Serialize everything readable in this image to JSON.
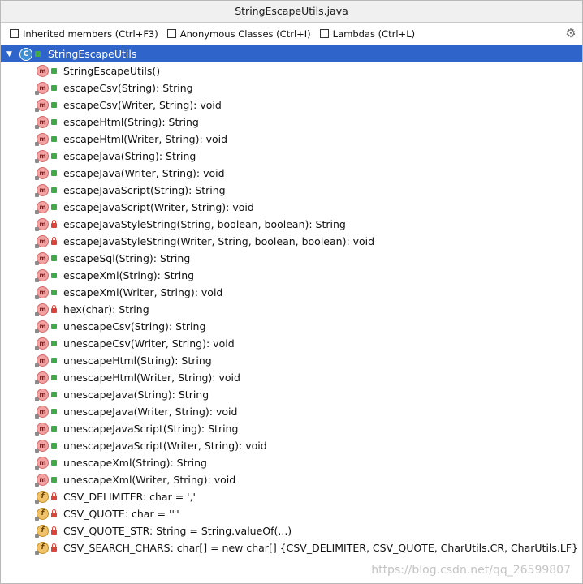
{
  "window": {
    "title": "StringEscapeUtils.java"
  },
  "toolbar": {
    "options": [
      {
        "label": "Inherited members (Ctrl+F3)",
        "checked": false
      },
      {
        "label": "Anonymous Classes (Ctrl+I)",
        "checked": false
      },
      {
        "label": "Lambdas (Ctrl+L)",
        "checked": false
      }
    ],
    "settings_icon": "gear-icon"
  },
  "tree": {
    "root": {
      "label": "StringEscapeUtils",
      "icon": "class-icon",
      "visibility": "public"
    },
    "members": [
      {
        "label": "StringEscapeUtils()",
        "kind": "method",
        "visibility": "public"
      },
      {
        "label": "escapeCsv(String): String",
        "kind": "method",
        "visibility": "public"
      },
      {
        "label": "escapeCsv(Writer, String): void",
        "kind": "method",
        "visibility": "public"
      },
      {
        "label": "escapeHtml(String): String",
        "kind": "method",
        "visibility": "public"
      },
      {
        "label": "escapeHtml(Writer, String): void",
        "kind": "method",
        "visibility": "public"
      },
      {
        "label": "escapeJava(String): String",
        "kind": "method",
        "visibility": "public"
      },
      {
        "label": "escapeJava(Writer, String): void",
        "kind": "method",
        "visibility": "public"
      },
      {
        "label": "escapeJavaScript(String): String",
        "kind": "method",
        "visibility": "public"
      },
      {
        "label": "escapeJavaScript(Writer, String): void",
        "kind": "method",
        "visibility": "public"
      },
      {
        "label": "escapeJavaStyleString(String, boolean, boolean): String",
        "kind": "method",
        "visibility": "private"
      },
      {
        "label": "escapeJavaStyleString(Writer, String, boolean, boolean): void",
        "kind": "method",
        "visibility": "private"
      },
      {
        "label": "escapeSql(String): String",
        "kind": "method",
        "visibility": "public"
      },
      {
        "label": "escapeXml(String): String",
        "kind": "method",
        "visibility": "public"
      },
      {
        "label": "escapeXml(Writer, String): void",
        "kind": "method",
        "visibility": "public"
      },
      {
        "label": "hex(char): String",
        "kind": "method",
        "visibility": "private"
      },
      {
        "label": "unescapeCsv(String): String",
        "kind": "method",
        "visibility": "public"
      },
      {
        "label": "unescapeCsv(Writer, String): void",
        "kind": "method",
        "visibility": "public"
      },
      {
        "label": "unescapeHtml(String): String",
        "kind": "method",
        "visibility": "public"
      },
      {
        "label": "unescapeHtml(Writer, String): void",
        "kind": "method",
        "visibility": "public"
      },
      {
        "label": "unescapeJava(String): String",
        "kind": "method",
        "visibility": "public"
      },
      {
        "label": "unescapeJava(Writer, String): void",
        "kind": "method",
        "visibility": "public"
      },
      {
        "label": "unescapeJavaScript(String): String",
        "kind": "method",
        "visibility": "public"
      },
      {
        "label": "unescapeJavaScript(Writer, String): void",
        "kind": "method",
        "visibility": "public"
      },
      {
        "label": "unescapeXml(String): String",
        "kind": "method",
        "visibility": "public"
      },
      {
        "label": "unescapeXml(Writer, String): void",
        "kind": "method",
        "visibility": "public"
      },
      {
        "label": "CSV_DELIMITER: char = ','",
        "kind": "field",
        "visibility": "private"
      },
      {
        "label": "CSV_QUOTE: char = '\"'",
        "kind": "field",
        "visibility": "private"
      },
      {
        "label": "CSV_QUOTE_STR: String = String.valueOf(...)",
        "kind": "field",
        "visibility": "private"
      },
      {
        "label": "CSV_SEARCH_CHARS: char[] = new char[] {CSV_DELIMITER, CSV_QUOTE, CharUtils.CR, CharUtils.LF}",
        "kind": "field",
        "visibility": "private"
      }
    ]
  },
  "watermark": "https://blog.csdn.net/qq_26599807",
  "colors": {
    "selection": "#2f65ca",
    "method_icon": "#f2a2a2",
    "field_icon": "#f0c36a",
    "public": "#41a94a",
    "private": "#d8453b"
  }
}
